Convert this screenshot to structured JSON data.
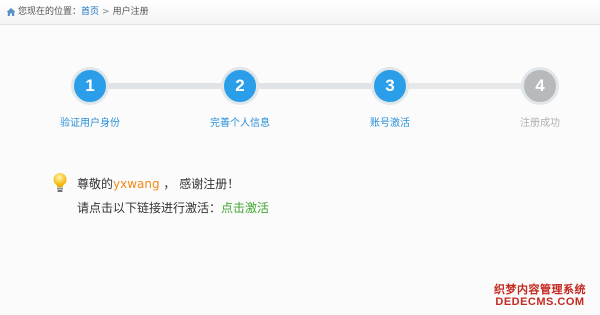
{
  "breadcrumb": {
    "prefix": "您现在的位置：",
    "home": "首页",
    "separator": ">",
    "current": "用户注册"
  },
  "steps": [
    {
      "number": "1",
      "label": "验证用户身份",
      "state": "active"
    },
    {
      "number": "2",
      "label": "完善个人信息",
      "state": "active"
    },
    {
      "number": "3",
      "label": "账号激活",
      "state": "active"
    },
    {
      "number": "4",
      "label": "注册成功",
      "state": "inactive"
    }
  ],
  "message": {
    "greeting_prefix": "尊敬的",
    "username": "yxwang",
    "greeting_suffix": " ，  感谢注册！",
    "instruction": "请点击以下链接进行激活：",
    "activate_link": "点击激活"
  },
  "watermark": {
    "line1": "织梦内容管理系统",
    "line2": "DEDECMS.COM"
  },
  "colors": {
    "accent": "#2a9ee8",
    "inactive": "#b7b9bb",
    "username": "#f08a1c",
    "link_green": "#3fa62c",
    "breadcrumb_link": "#1a74c7"
  },
  "icons": {
    "breadcrumb": "home-icon",
    "message": "lightbulb-icon"
  }
}
